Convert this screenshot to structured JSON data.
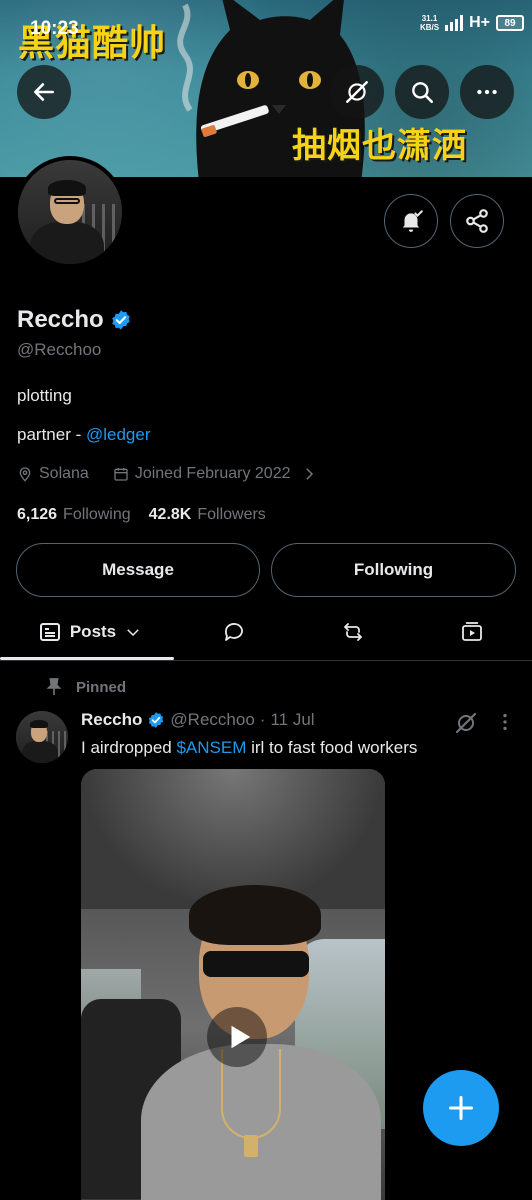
{
  "status_bar": {
    "time": "10:23",
    "net_speed_value": "31.1",
    "net_speed_unit": "KB/S",
    "network_type": "H+",
    "battery": "89"
  },
  "banner": {
    "text_top": "黑猫酷帅",
    "text_bottom": "抽烟也潇洒"
  },
  "profile": {
    "name": "Reccho",
    "handle": "@Recchoo",
    "bio_line1": "plotting",
    "bio_partner_prefix": "partner - ",
    "bio_partner_link": "@ledger",
    "location": "Solana",
    "joined": "Joined February 2022",
    "following_count": "6,126",
    "following_label": "Following",
    "followers_count": "42.8K",
    "followers_label": "Followers"
  },
  "actions": {
    "message": "Message",
    "following": "Following"
  },
  "tabs": {
    "posts": "Posts"
  },
  "tweet": {
    "pinned_label": "Pinned",
    "name": "Reccho",
    "handle": "@Recchoo",
    "dot": "·",
    "date": "11 Jul",
    "text_before": "I airdropped ",
    "text_cashtag": "$ANSEM",
    "text_after": " irl to fast food workers"
  },
  "colors": {
    "accent": "#1d9bf0",
    "background": "#000000",
    "text_primary": "#e7e9ea",
    "text_secondary": "#71767b",
    "banner_text": "#f5d417"
  },
  "icons": {
    "back": "arrow-left-icon",
    "grok": "grok-icon",
    "search": "search-icon",
    "more": "more-horizontal-icon",
    "notify": "bell-check-icon",
    "share": "share-icon",
    "location": "location-pin-icon",
    "calendar": "calendar-icon",
    "compose": "plus-icon"
  }
}
